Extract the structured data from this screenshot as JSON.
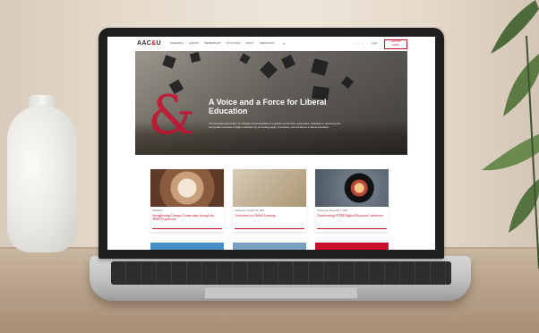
{
  "site": {
    "logo_left": "AAC",
    "logo_accent": "&",
    "logo_right": "U",
    "nav_items": [
      "RESEARCH",
      "EVENTS",
      "MEMBERSHIP",
      "INITIATIVES",
      "ABOUT",
      "NEWSROOM"
    ],
    "login": "Login",
    "support_line1": "SUPPORT",
    "support_line2": "AAC&U"
  },
  "hero": {
    "title": "A Voice and a Force for Liberal Education",
    "description": "The American Association of Colleges and Universities is a global membership organization dedicated to advancing the democratic purposes of higher education by promoting equity, innovation, and excellence in liberal education."
  },
  "cards": [
    {
      "meta": "Publication",
      "title": "Strengthening Campus Connections through the TRHT Framework"
    },
    {
      "meta": "Conference  |  October 10, 2024",
      "title": "Conference on Global Learning"
    },
    {
      "meta": "Conference  |  November 7, 2024",
      "title": "Transforming STEM Higher Education Conference"
    }
  ],
  "colors": {
    "accent": "#c8102e",
    "bezel": "#1e1e1e",
    "wall": "#e6dbcd"
  }
}
